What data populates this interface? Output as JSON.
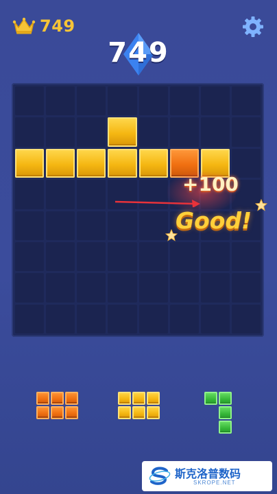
{
  "header": {
    "best_score": "749",
    "crown_icon": "crown-icon",
    "settings_icon": "gear-icon"
  },
  "score": {
    "current": "749"
  },
  "feedback": {
    "bonus": "+100",
    "praise": "Good!"
  },
  "board": {
    "rows": 8,
    "cols": 8,
    "filled": [
      {
        "row": 1,
        "col": 3,
        "color": "yellow"
      },
      {
        "row": 2,
        "col": 0,
        "color": "yellow"
      },
      {
        "row": 2,
        "col": 1,
        "color": "yellow"
      },
      {
        "row": 2,
        "col": 2,
        "color": "yellow"
      },
      {
        "row": 2,
        "col": 3,
        "color": "yellow"
      },
      {
        "row": 2,
        "col": 4,
        "color": "yellow"
      },
      {
        "row": 2,
        "col": 5,
        "color": "orange"
      },
      {
        "row": 2,
        "col": 6,
        "color": "yellow"
      }
    ]
  },
  "tray": {
    "pieces": [
      {
        "name": "orange-2x3-piece",
        "color": "orange",
        "shape": [
          [
            1,
            1,
            1
          ],
          [
            1,
            1,
            1
          ]
        ]
      },
      {
        "name": "yellow-2x3-piece",
        "color": "yellow",
        "shape": [
          [
            1,
            1,
            1
          ],
          [
            1,
            1,
            1
          ]
        ]
      },
      {
        "name": "green-l-piece",
        "color": "green",
        "shape": [
          [
            1,
            1
          ],
          [
            0,
            1
          ],
          [
            0,
            1
          ]
        ]
      }
    ]
  },
  "watermark": {
    "title": "斯克洛普数码",
    "subtitle": "SKROPE.NET"
  },
  "colors": {
    "background": "#3a4a98",
    "board": "#1f2a5c",
    "gold": "#f6c437",
    "orange": "#f07011",
    "green": "#35b637",
    "score_gem": "#3a7bf0"
  }
}
